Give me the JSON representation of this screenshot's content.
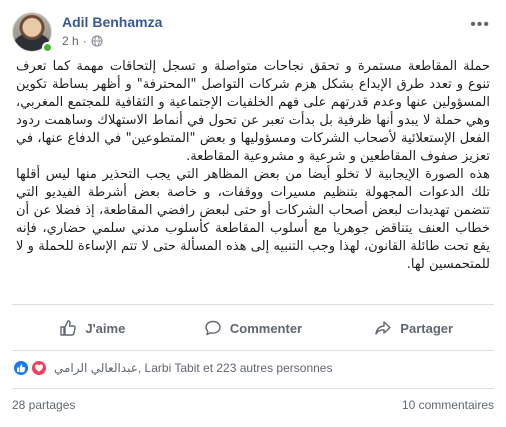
{
  "post": {
    "author": "Adil Benhamza",
    "time": "2 h",
    "separator": "·",
    "more": "•••",
    "paragraphs": [
      "حملة المقاطعة مستمرة و تحقق نجاحات متواصلة و تسجل إلتحاقات مهمة كما تعرف تنوع و تعدد طرق الإبداع بشكل هزم شركات التواصل \"المحترفة\" و أظهر بساطة تكوين المسؤولين عنها وعدم قدرتهم على فهم الخلفيات الإجتماعية و الثقافية للمجتمع المغربي، وهي حملة لا يبدو أنها ظرفية بل بدأت تعبر عن تحول في أنماط الاستهلاك وساهمت ردود الفعل الإستعلائية لأصحاب الشركات ومسؤوليها و بعض \"المتطوعين\" في الدفاع عنها، في تعزيز صفوف المقاطعين و شرعية و مشروعية المقاطعة.",
      "هذه الصورة الإيجابية لا تخلو أيضا من بعض المظاهر التي يجب التحذير منها ليس أقلها تلك الدعوات المجهولة بتنظيم مسيرات ووقفات، و خاصة بعض أشرطة الفيديو التي تتضمن تهديدات لبعض أصحاب الشركات أو حتى لبعض رافضي المقاطعة، إذ فضلا عن أن خطاب العنف يتناقض جوهريا مع أسلوب المقاطعة كأسلوب مدني سلمي حضاري، فإنه يقع تحت طائلة القانون، لهذا وجب التنبيه إلى هذه المسألة حتى لا تتم الإساءة للحملة و لا للمتحمسين لها."
    ]
  },
  "actions": {
    "like": "J'aime",
    "comment": "Commenter",
    "share": "Partager"
  },
  "reactions": {
    "summary": "عبدالعالي الرامي, Larbi Tabit et 223 autres personnes"
  },
  "stats": {
    "shares": "28 partages",
    "comments": "10 commentaires"
  },
  "colors": {
    "link": "#385898",
    "like": "#1877f2",
    "love": "#f33e58",
    "online": "#42b72a"
  }
}
